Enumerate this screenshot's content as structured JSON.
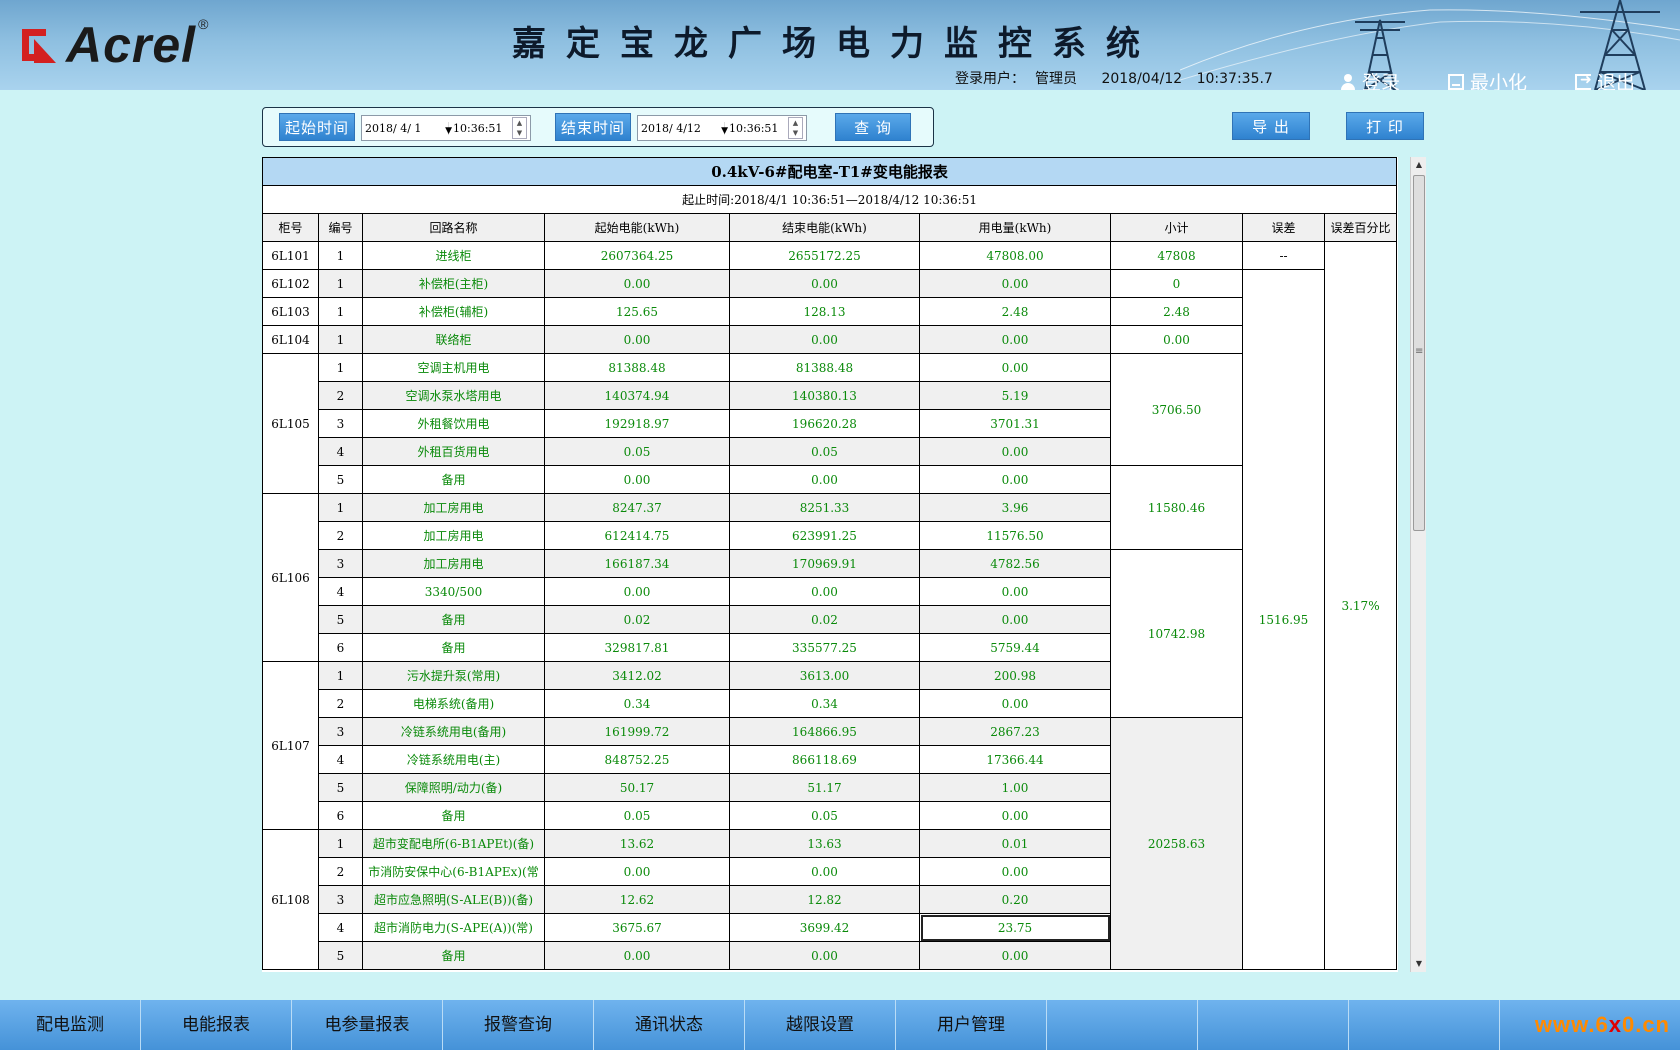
{
  "header": {
    "logo_text": "Acrel",
    "logo_reg": "®",
    "title": "嘉定宝龙广场电力监控系统",
    "user_label": "登录用户：",
    "user_name": "管理员",
    "date": "2018/04/12",
    "time": "10:37:35.7",
    "login": "登录",
    "minimize": "最小化",
    "exit": "退出"
  },
  "query": {
    "start_label": "起始时间",
    "start_date": "2018/ 4/ 1",
    "start_time": "10:36:51",
    "end_label": "结束时间",
    "end_date": "2018/ 4/12",
    "end_time": "10:36:51",
    "search": "查 询",
    "export": "导 出",
    "print": "打 印"
  },
  "report": {
    "title": "0.4kV-6#配电室-T1#变电能报表",
    "range": "起止时间:2018/4/1 10:36:51—2018/4/12 10:36:51",
    "columns": [
      "柜号",
      "编号",
      "回路名称",
      "起始电能(kWh)",
      "结束电能(kWh)",
      "用电量(kWh)",
      "小计",
      "误差",
      "误差百分比"
    ],
    "error_value": "1516.95",
    "error_percent": "3.17%",
    "first_error": "--",
    "rows": [
      {
        "cab": "6L101",
        "idx": "1",
        "name": "进线柜",
        "start": "2607364.25",
        "end": "2655172.25",
        "usage": "47808.00"
      },
      {
        "cab": "6L102",
        "idx": "1",
        "name": "补偿柜(主柜)",
        "start": "0.00",
        "end": "0.00",
        "usage": "0.00"
      },
      {
        "cab": "6L103",
        "idx": "1",
        "name": "补偿柜(辅柜)",
        "start": "125.65",
        "end": "128.13",
        "usage": "2.48"
      },
      {
        "cab": "6L104",
        "idx": "1",
        "name": "联络柜",
        "start": "0.00",
        "end": "0.00",
        "usage": "0.00"
      },
      {
        "cab": "6L105",
        "idx": "1",
        "name": "空调主机用电",
        "start": "81388.48",
        "end": "81388.48",
        "usage": "0.00"
      },
      {
        "cab": "",
        "idx": "2",
        "name": "空调水泵水塔用电",
        "start": "140374.94",
        "end": "140380.13",
        "usage": "5.19"
      },
      {
        "cab": "",
        "idx": "3",
        "name": "外租餐饮用电",
        "start": "192918.97",
        "end": "196620.28",
        "usage": "3701.31"
      },
      {
        "cab": "",
        "idx": "4",
        "name": "外租百货用电",
        "start": "0.05",
        "end": "0.05",
        "usage": "0.00"
      },
      {
        "cab": "",
        "idx": "5",
        "name": "备用",
        "start": "0.00",
        "end": "0.00",
        "usage": "0.00"
      },
      {
        "cab": "6L106",
        "idx": "1",
        "name": "加工房用电",
        "start": "8247.37",
        "end": "8251.33",
        "usage": "3.96"
      },
      {
        "cab": "",
        "idx": "2",
        "name": "加工房用电",
        "start": "612414.75",
        "end": "623991.25",
        "usage": "11576.50"
      },
      {
        "cab": "",
        "idx": "3",
        "name": "加工房用电",
        "start": "166187.34",
        "end": "170969.91",
        "usage": "4782.56"
      },
      {
        "cab": "",
        "idx": "4",
        "name": "3340/500",
        "start": "0.00",
        "end": "0.00",
        "usage": "0.00"
      },
      {
        "cab": "",
        "idx": "5",
        "name": "备用",
        "start": "0.02",
        "end": "0.02",
        "usage": "0.00"
      },
      {
        "cab": "",
        "idx": "6",
        "name": "备用",
        "start": "329817.81",
        "end": "335577.25",
        "usage": "5759.44"
      },
      {
        "cab": "6L107",
        "idx": "1",
        "name": "污水提升泵(常用)",
        "start": "3412.02",
        "end": "3613.00",
        "usage": "200.98"
      },
      {
        "cab": "",
        "idx": "2",
        "name": "电梯系统(备用)",
        "start": "0.34",
        "end": "0.34",
        "usage": "0.00"
      },
      {
        "cab": "",
        "idx": "3",
        "name": "冷链系统用电(备用)",
        "start": "161999.72",
        "end": "164866.95",
        "usage": "2867.23"
      },
      {
        "cab": "",
        "idx": "4",
        "name": "冷链系统用电(主)",
        "start": "848752.25",
        "end": "866118.69",
        "usage": "17366.44"
      },
      {
        "cab": "",
        "idx": "5",
        "name": "保障照明/动力(备)",
        "start": "50.17",
        "end": "51.17",
        "usage": "1.00"
      },
      {
        "cab": "",
        "idx": "6",
        "name": "备用",
        "start": "0.05",
        "end": "0.05",
        "usage": "0.00"
      },
      {
        "cab": "6L108",
        "idx": "1",
        "name": "超市变配电所(6-B1APEt)(备)",
        "start": "13.62",
        "end": "13.63",
        "usage": "0.01"
      },
      {
        "cab": "",
        "idx": "2",
        "name": "市消防安保中心(6-B1APEx)(常",
        "start": "0.00",
        "end": "0.00",
        "usage": "0.00"
      },
      {
        "cab": "",
        "idx": "3",
        "name": "超市应急照明(S-ALE(B))(备)",
        "start": "12.62",
        "end": "12.82",
        "usage": "0.20"
      },
      {
        "cab": "",
        "idx": "4",
        "name": "超市消防电力(S-APE(A))(常)",
        "start": "3675.67",
        "end": "3699.42",
        "usage": "23.75"
      },
      {
        "cab": "",
        "idx": "5",
        "name": "备用",
        "start": "0.00",
        "end": "0.00",
        "usage": "0.00"
      }
    ],
    "subtotals": [
      "47808",
      "0",
      "2.48",
      "0.00",
      "3706.50",
      "11580.46",
      "10742.98",
      "20258.63"
    ]
  },
  "nav": [
    "配电监测",
    "电能报表",
    "电参量报表",
    "报警查询",
    "通讯状态",
    "越限设置",
    "用户管理",
    "",
    "",
    ""
  ],
  "watermark": {
    "a": "www.6",
    "x": "x",
    "b": "0.cn"
  }
}
